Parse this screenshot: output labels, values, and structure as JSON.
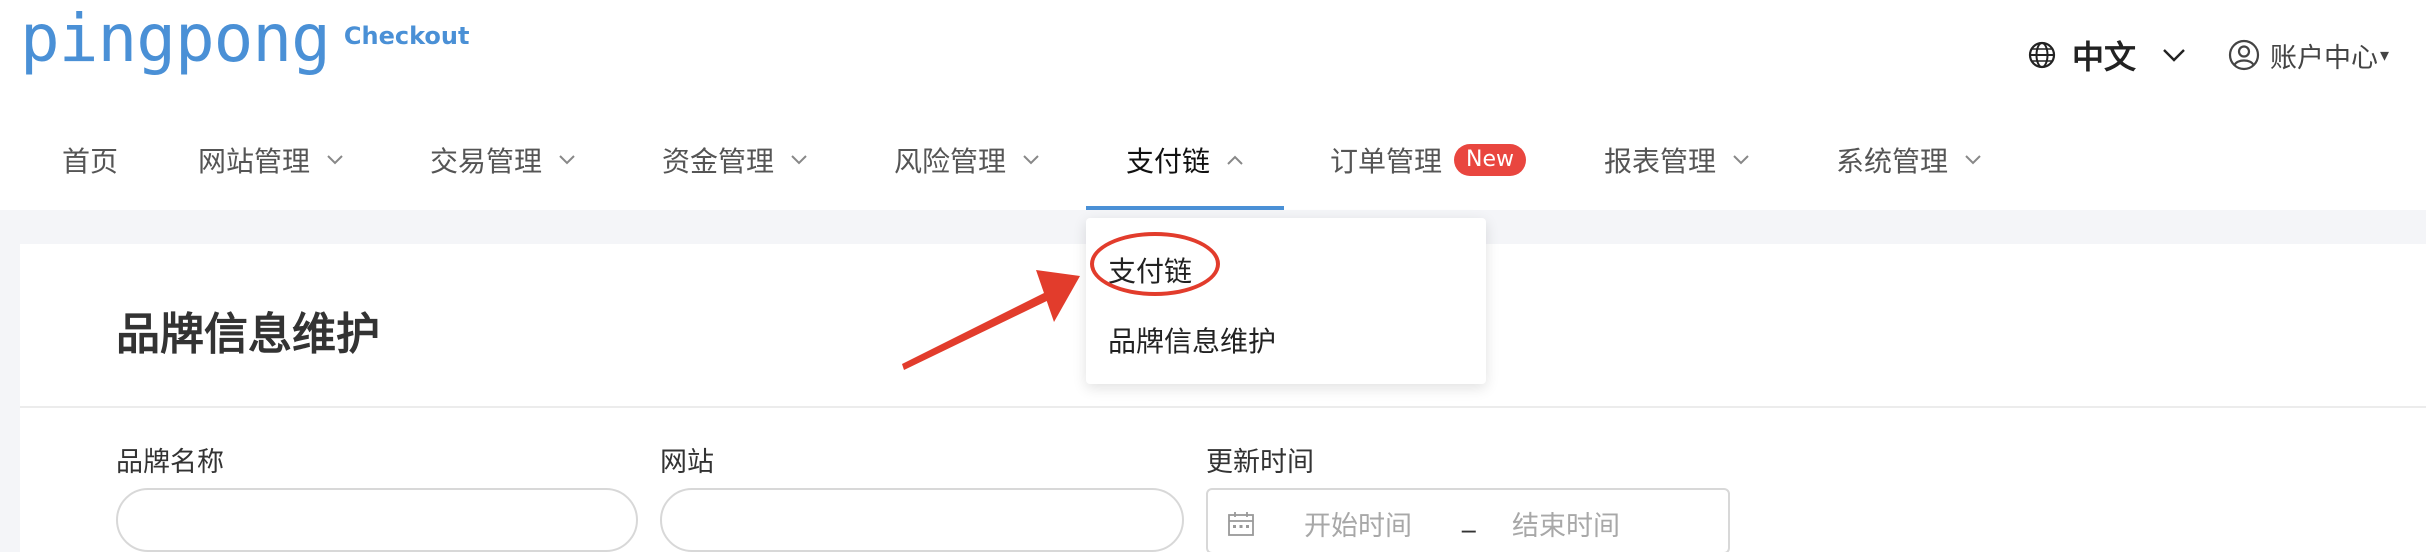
{
  "header": {
    "logo_main": "pingpong",
    "logo_sub": "Checkout",
    "language_label": "中文",
    "account_label": "账户中心",
    "account_caret": "▾"
  },
  "nav": {
    "items": [
      {
        "label": "首页"
      },
      {
        "label": "网站管理"
      },
      {
        "label": "交易管理"
      },
      {
        "label": "资金管理"
      },
      {
        "label": "风险管理"
      },
      {
        "label": "支付链"
      },
      {
        "label": "订单管理",
        "badge": "New"
      },
      {
        "label": "报表管理"
      },
      {
        "label": "系统管理"
      }
    ],
    "active_index": 5
  },
  "dropdown": {
    "items": [
      {
        "label": "支付链"
      },
      {
        "label": "品牌信息维护"
      }
    ]
  },
  "page": {
    "title": "品牌信息维护",
    "filters": {
      "brand_name_label": "品牌名称",
      "website_label": "网站",
      "update_time_label": "更新时间",
      "start_placeholder": "开始时间",
      "range_separator": "_",
      "end_placeholder": "结束时间"
    }
  },
  "colors": {
    "brand": "#4a90d6",
    "badge": "#e9463f",
    "annotation": "#e23c2c"
  }
}
